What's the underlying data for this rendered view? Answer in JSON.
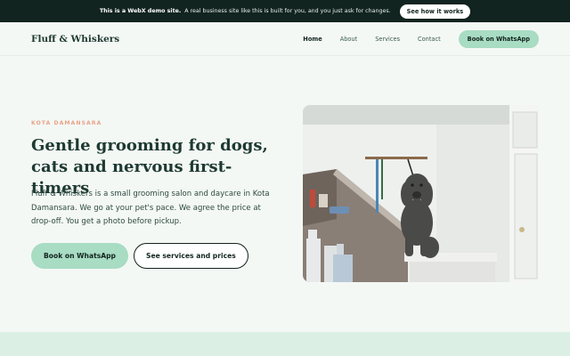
{
  "demo_bar": {
    "strong_text": "This is a WebX demo site.",
    "message": "A real business site like this is built for you, and you just ask for changes.",
    "cta_label": "See how it works"
  },
  "header": {
    "logo": "Fluff & Whiskers",
    "nav": [
      {
        "label": "Home",
        "active": true
      },
      {
        "label": "About",
        "active": false
      },
      {
        "label": "Services",
        "active": false
      },
      {
        "label": "Contact",
        "active": false
      }
    ],
    "cta_label": "Book on WhatsApp"
  },
  "hero": {
    "eyebrow": "KOTA DAMANSARA",
    "title": "Gentle grooming for dogs, cats and nervous first-timers",
    "description": "Fluff & Whiskers is a small grooming salon and daycare in Kota Damansara. We go at your pet's pace. We agree the price at drop-off. You get a photo before pickup.",
    "primary_button": "Book on WhatsApp",
    "secondary_button": "See services and prices",
    "photo_subject": "poodle-on-grooming-table"
  },
  "colors": {
    "accent": "#a8dcc3",
    "dark": "#12241f",
    "eyebrow": "#e8a48a",
    "background": "#f4f8f5"
  }
}
